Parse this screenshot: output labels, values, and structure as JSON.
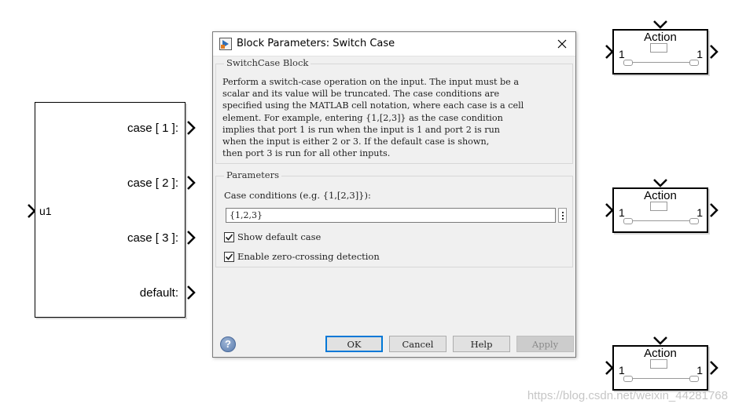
{
  "switch_block": {
    "input_label": "u1",
    "cases": [
      "case [ 1 ]:",
      "case [ 2 ]:",
      "case [ 3 ]:",
      "default:"
    ]
  },
  "action_blocks": [
    {
      "title": "Action",
      "in_label": "1",
      "out_label": "1"
    },
    {
      "title": "Action",
      "in_label": "1",
      "out_label": "1"
    },
    {
      "title": "Action",
      "in_label": "1",
      "out_label": "1"
    }
  ],
  "dialog": {
    "title": "Block Parameters: Switch Case",
    "block_group_title": "SwitchCase Block",
    "description": "Perform a switch-case operation on the input.  The input must be a\nscalar and its value will be truncated.  The case conditions are\nspecified using the MATLAB cell notation, where each case is a cell\nelement.  For example, entering {1,[2,3]} as the case condition\nimplies that port 1 is run when the input is 1 and port 2 is run\nwhen the input is either 2 or 3.  If the default case is shown,\nthen port 3 is run for all other inputs.",
    "params_group_title": "Parameters",
    "case_conditions_label": "Case conditions (e.g. {1,[2,3]}):",
    "case_conditions_value": "{1,2,3}",
    "show_default_case_label": "Show default case",
    "show_default_case_checked": true,
    "zero_crossing_label": "Enable zero-crossing detection",
    "zero_crossing_checked": true,
    "buttons": {
      "ok": "OK",
      "cancel": "Cancel",
      "help": "Help",
      "apply": "Apply"
    },
    "help_icon": "?"
  },
  "icons": {
    "title_icon": "simulink-block-icon",
    "close": "close-icon",
    "help": "help-circle-icon"
  },
  "colors": {
    "default_button_border": "#0078d7",
    "help_icon": "#5a7cae"
  },
  "watermark": "https://blog.csdn.net/weixin_44281768"
}
